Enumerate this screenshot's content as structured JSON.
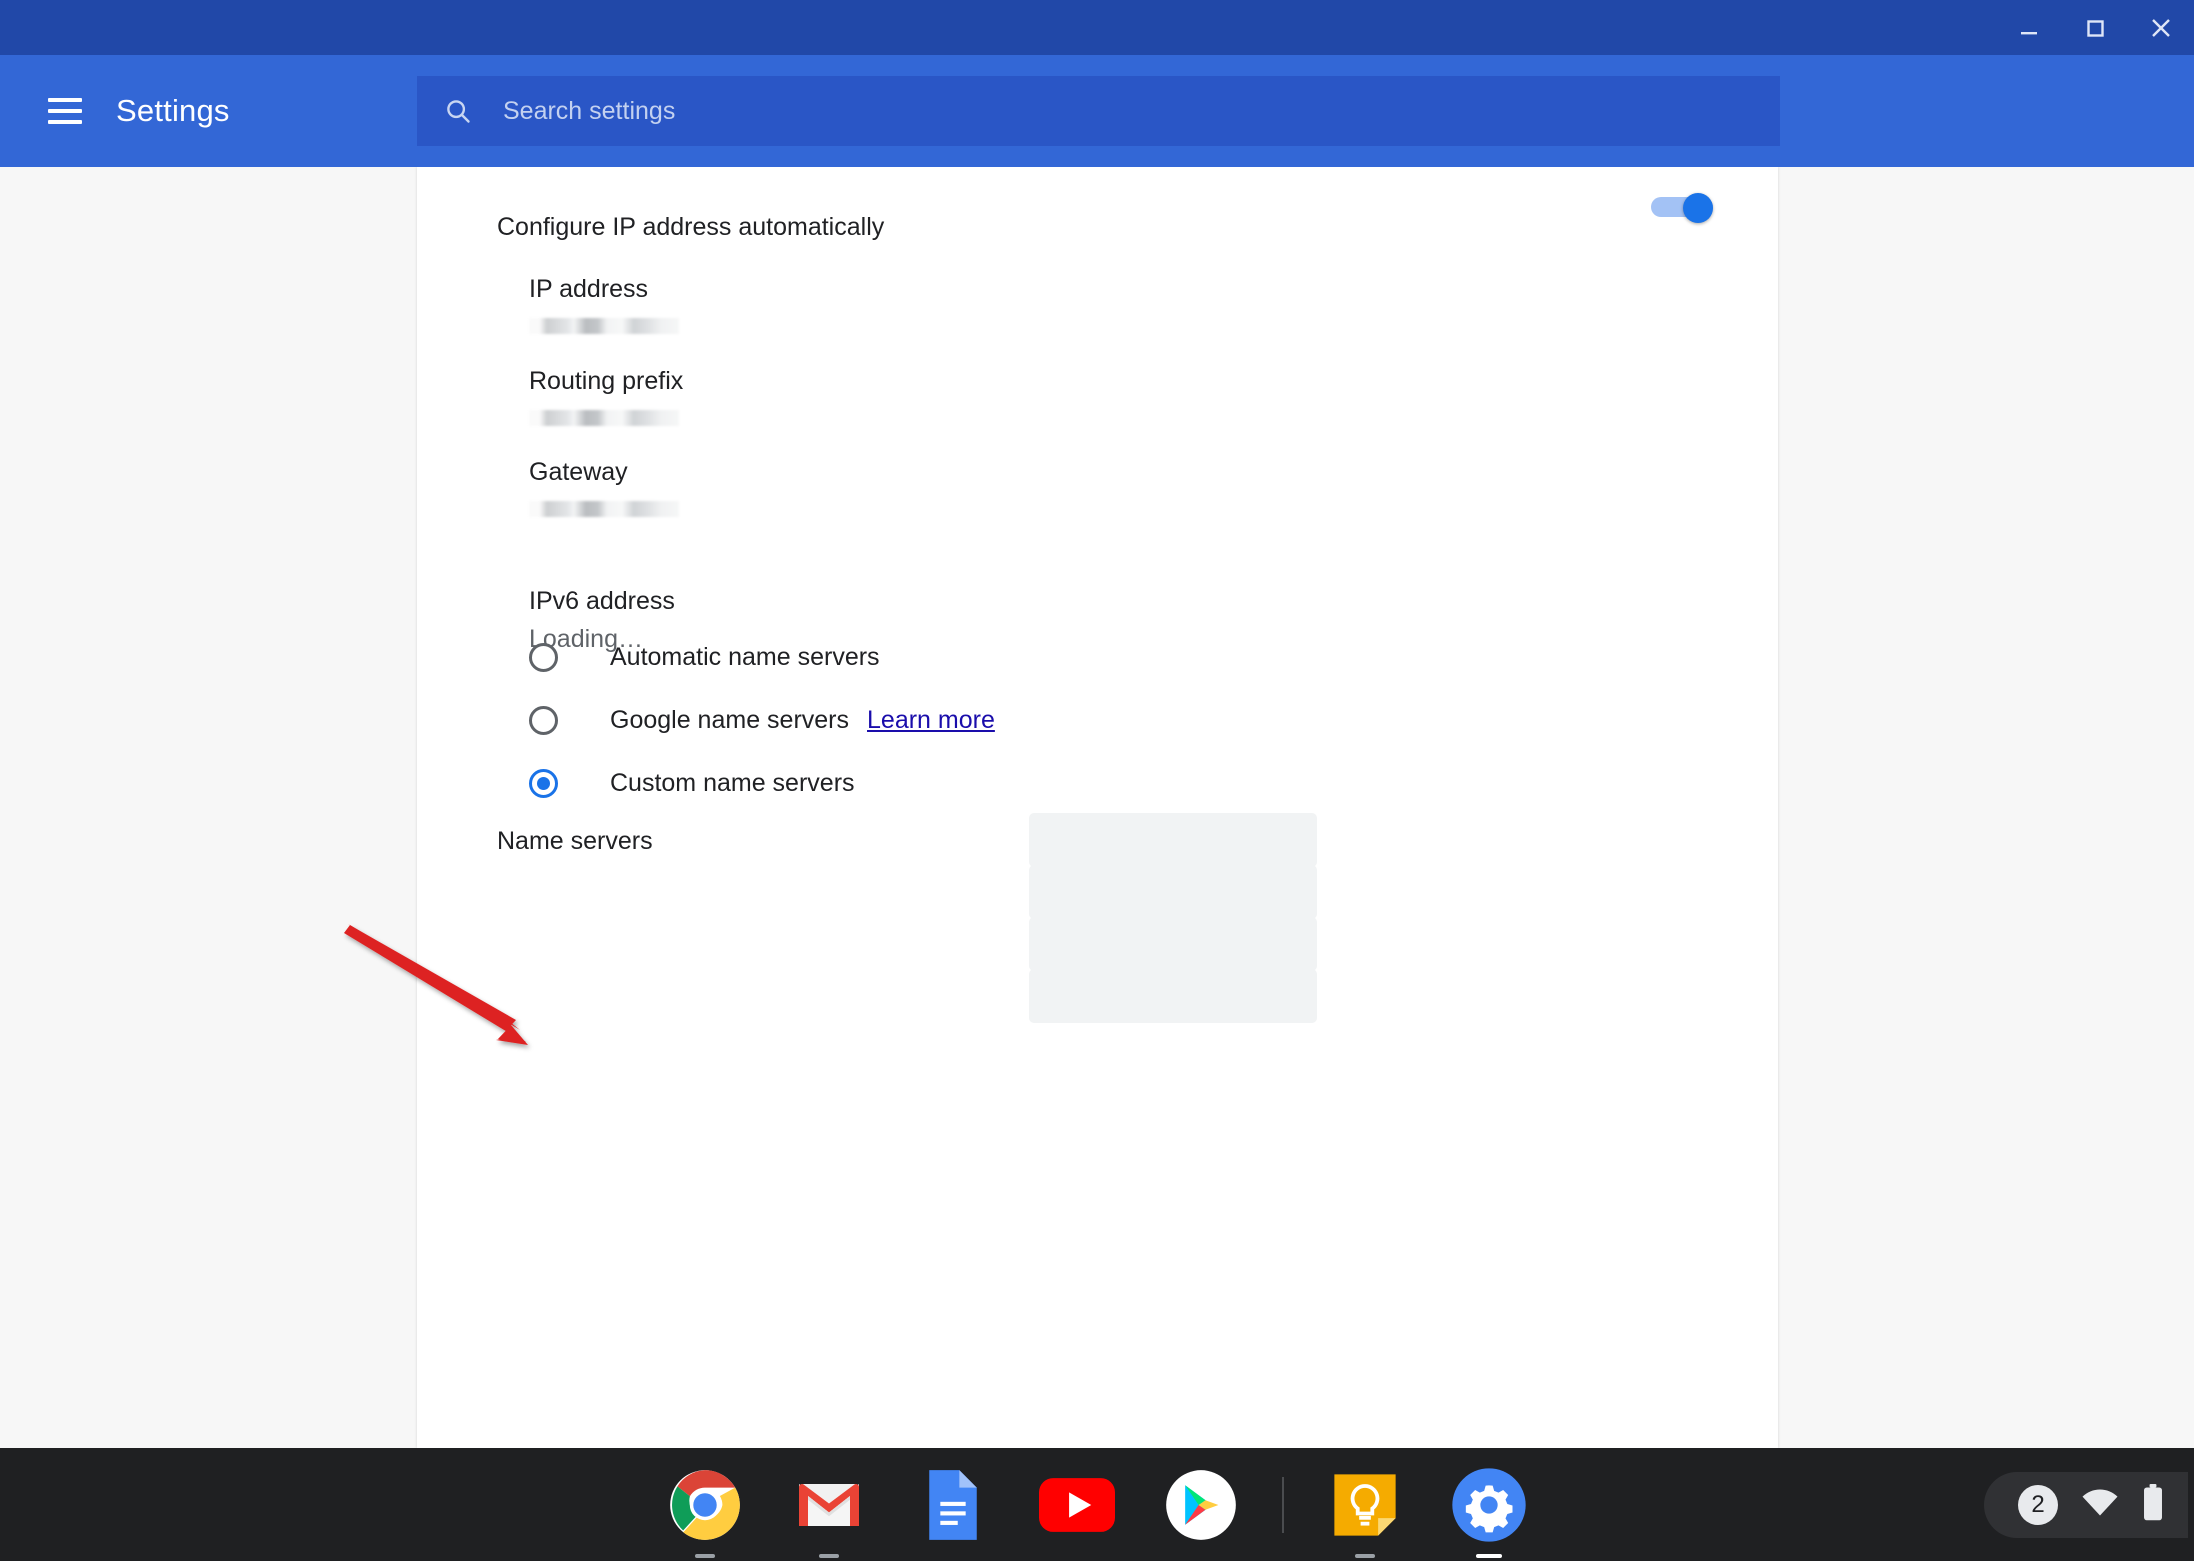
{
  "window": {
    "minimize_label": "Minimize",
    "maximize_label": "Maximize",
    "close_label": "Close"
  },
  "header": {
    "menu_label": "Main menu",
    "title": "Settings",
    "search_icon": "search-icon",
    "search_placeholder": "Search settings",
    "search_value": ""
  },
  "colors": {
    "titlebar": "#2148a8",
    "header": "#3367d6",
    "searchbar": "#2a56c6",
    "accent": "#1a73e8",
    "link": "#1a0dab",
    "annotation": "#dd2222",
    "shelf": "#1f2022"
  },
  "network": {
    "auto_ip_label": "Configure IP address automatically",
    "auto_ip_enabled": true,
    "fields": [
      {
        "name": "IP address",
        "value": "",
        "redacted": true
      },
      {
        "name": "Routing prefix",
        "value": "",
        "redacted": true
      },
      {
        "name": "Gateway",
        "value": "",
        "redacted": true
      },
      {
        "name": "IPv6 address",
        "value": "Loading…",
        "redacted": false
      }
    ],
    "name_servers": {
      "title": "Name servers",
      "selected": "custom",
      "options": [
        {
          "id": "automatic",
          "label": "Automatic name servers",
          "checked": false
        },
        {
          "id": "google",
          "label": "Google name servers",
          "checked": false,
          "link": "Learn more"
        },
        {
          "id": "custom",
          "label": "Custom name servers",
          "checked": true
        }
      ],
      "custom_inputs": [
        {
          "value": "",
          "placeholder": ""
        },
        {
          "value": "",
          "placeholder": ""
        },
        {
          "value": "",
          "placeholder": ""
        },
        {
          "value": "",
          "placeholder": ""
        }
      ]
    }
  },
  "annotation": {
    "type": "arrow",
    "points_to": "Custom name servers radio button"
  },
  "shelf": {
    "apps": [
      {
        "id": "chrome",
        "label": "Google Chrome",
        "running": true,
        "active": false
      },
      {
        "id": "gmail",
        "label": "Gmail",
        "running": true,
        "active": false
      },
      {
        "id": "docs",
        "label": "Google Docs",
        "running": false,
        "active": false
      },
      {
        "id": "youtube",
        "label": "YouTube",
        "running": false,
        "active": false
      },
      {
        "id": "play",
        "label": "Play Store",
        "running": false,
        "active": false
      },
      {
        "id": "keep",
        "label": "Google Keep",
        "running": true,
        "active": false
      },
      {
        "id": "settings",
        "label": "Settings",
        "running": true,
        "active": true
      }
    ],
    "tray": {
      "notification_count": "2",
      "wifi_icon": "wifi-icon",
      "battery_icon": "battery-icon"
    }
  }
}
